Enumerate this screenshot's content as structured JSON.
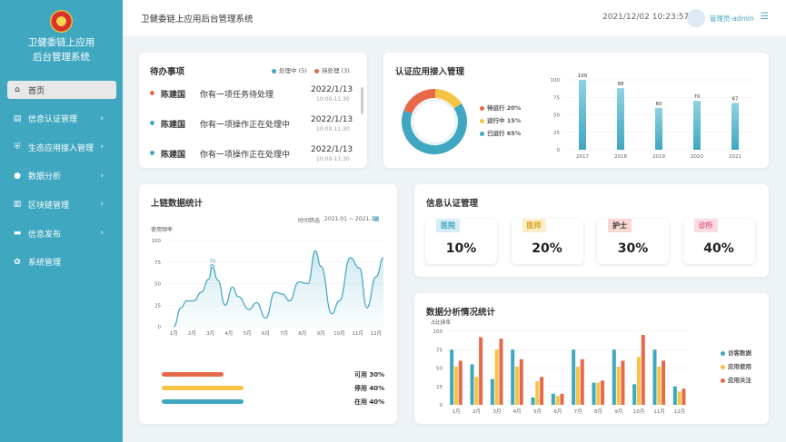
{
  "sidebar": {
    "title_line1": "卫健委链上应用",
    "title_line2": "后台管理系统",
    "items": [
      {
        "label": "首页",
        "icon": "home-icon",
        "glyph": "⌂"
      },
      {
        "label": "信息认证管理",
        "icon": "document-icon",
        "glyph": "▤"
      },
      {
        "label": "生态应用接入管理",
        "icon": "shield-icon",
        "glyph": "⛨"
      },
      {
        "label": "数据分析",
        "icon": "user-icon",
        "glyph": "●"
      },
      {
        "label": "区块链管理",
        "icon": "book-icon",
        "glyph": "▥"
      },
      {
        "label": "信息发布",
        "icon": "message-icon",
        "glyph": "▬"
      },
      {
        "label": "系统管理",
        "icon": "gear-icon",
        "glyph": "✿"
      }
    ]
  },
  "header": {
    "title": "卫健委链上应用后台管理系统",
    "datetime": "2021/12/02 10:23:57",
    "user": "管理员-admin"
  },
  "todo": {
    "title": "待办事项",
    "legend_processing": "处理中 (5)",
    "legend_pending": "待处理 (3)",
    "rows": [
      {
        "name": "陈建国",
        "text": "你有一项任务待处理",
        "date": "2022/1/13",
        "time": "10:00-11:30",
        "color": "#e8684a"
      },
      {
        "name": "陈建国",
        "text": "你有一项操作正在处理中",
        "date": "2022/1/13",
        "time": "10:00-11:30",
        "color": "#3fa7c0"
      },
      {
        "name": "陈建国",
        "text": "你有一项操作正在处理中",
        "date": "2022/1/13",
        "time": "10:00-11:30",
        "color": "#3fa7c0"
      }
    ]
  },
  "auth_access": {
    "title": "认证应用接入管理",
    "legend": [
      {
        "label": "待运行 20%",
        "color": "#e8684a",
        "pct": 20
      },
      {
        "label": "运行中 15%",
        "color": "#f6c445",
        "pct": 15
      },
      {
        "label": "已运行 65%",
        "color": "#3fa7c0",
        "pct": 65
      }
    ]
  },
  "chain_stats": {
    "title": "上链数据统计",
    "time_filter_label": "时间筛选",
    "time_range": "2021-01 ~ 2021-12",
    "y_axis_label": "使用频率",
    "peak_label": "70",
    "progress": [
      {
        "label": "可用 30%",
        "color": "#e8684a",
        "pct": 30
      },
      {
        "label": "停用 40%",
        "color": "#f6c445",
        "pct": 40
      },
      {
        "label": "在用 40%",
        "color": "#3fa7c0",
        "pct": 40
      }
    ]
  },
  "info_auth": {
    "title": "信息认证管理",
    "boxes": [
      {
        "tag": "医院",
        "value": "10%",
        "tag_bg": "#d7ecf3",
        "tag_color": "#3fa7c0"
      },
      {
        "tag": "医师",
        "value": "20%",
        "tag_bg": "#fbeec8",
        "tag_color": "#d9a21e"
      },
      {
        "tag": "护士",
        "value": "30%",
        "tag_bg": "#f8d7d2",
        "tag_color": "#333"
      },
      {
        "tag": "诊所",
        "value": "40%",
        "tag_bg": "#fbdbe3",
        "tag_color": "#e06f8b"
      }
    ]
  },
  "analysis": {
    "title": "数据分析情况统计",
    "y_axis_label": "占比频率"
  },
  "chart_data": [
    {
      "type": "bar",
      "categories": [
        "2017",
        "2018",
        "2019",
        "2020",
        "2021"
      ],
      "values": [
        100,
        88,
        60,
        70,
        67
      ],
      "ylim": [
        0,
        100
      ],
      "yticks": [
        0,
        25,
        50,
        75,
        100
      ],
      "color": "#3fa7c0"
    },
    {
      "type": "line",
      "categories": [
        "1月",
        "2月",
        "3月",
        "4月",
        "5月",
        "6月",
        "7月",
        "8月",
        "9月",
        "10月",
        "11月",
        "12月"
      ],
      "x": [
        0.5,
        0.9,
        1.2,
        1.6,
        2.0,
        2.4,
        2.6,
        2.9,
        3.3,
        3.7,
        4.0,
        4.6,
        5.0,
        5.5,
        6.0,
        6.4,
        6.8,
        7.3,
        7.8,
        8.2,
        8.5,
        9.1,
        9.5,
        10.1,
        10.6,
        11.0,
        11.5,
        11.9
      ],
      "values": [
        0,
        22,
        30,
        30,
        40,
        55,
        70,
        54,
        25,
        46,
        35,
        20,
        28,
        10,
        40,
        38,
        30,
        52,
        50,
        88,
        70,
        15,
        30,
        80,
        68,
        22,
        58,
        80
      ],
      "ylim": [
        0,
        100
      ],
      "yticks": [
        0,
        25,
        50,
        75,
        100
      ],
      "color": "#3fa7c0"
    },
    {
      "type": "bar",
      "categories": [
        "1月",
        "2月",
        "3月",
        "4月",
        "5月",
        "6月",
        "7月",
        "8月",
        "9月",
        "10月",
        "11月",
        "12月"
      ],
      "ylim": [
        0,
        100
      ],
      "yticks": [
        0,
        25,
        50,
        75,
        100
      ],
      "legend": "right",
      "series": [
        {
          "name": "访客数据",
          "color": "#3fa7c0",
          "values": [
            75,
            55,
            35,
            75,
            10,
            15,
            75,
            30,
            75,
            28,
            75,
            25
          ]
        },
        {
          "name": "应用使用",
          "color": "#f6c445",
          "values": [
            52,
            38,
            75,
            52,
            32,
            12,
            52,
            30,
            52,
            65,
            52,
            18
          ]
        },
        {
          "name": "应用关注",
          "color": "#e8684a",
          "values": [
            60,
            92,
            90,
            62,
            38,
            15,
            62,
            33,
            60,
            95,
            60,
            22
          ]
        }
      ]
    }
  ]
}
